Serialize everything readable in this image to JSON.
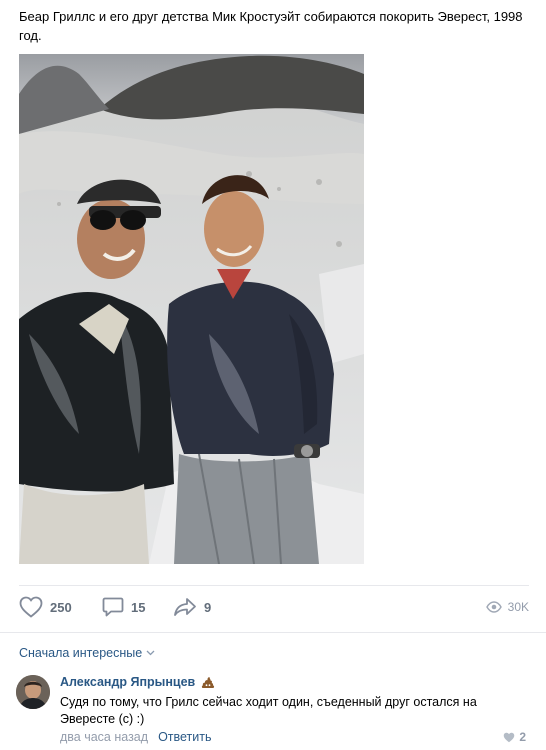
{
  "post": {
    "text": "Беар Гриллс и его друг детства Мик Кростуэйт собираются покорить Эверест, 1998 год."
  },
  "actions": {
    "likes": "250",
    "comments": "15",
    "shares": "9",
    "views": "30K"
  },
  "comments_sort_label": "Сначала интересные",
  "comment": {
    "author": "Александр Япрынцев",
    "text": "Судя по тому, что Грилс сейчас ходит один, съеденный друг остался на Эвересте (с) :)",
    "time": "два часа назад",
    "reply_label": "Ответить",
    "likes": "2"
  },
  "icons": {
    "like": "heart-icon",
    "comment": "comment-bubble-icon",
    "share": "share-arrow-icon",
    "views": "eye-icon",
    "sort": "chevron-down-icon",
    "badge": "poop-emoji-icon",
    "comment_like": "heart-icon"
  },
  "colors": {
    "link": "#2a5885",
    "muted": "#939cab",
    "action": "#626d7a",
    "divider": "#e7e8ec"
  }
}
